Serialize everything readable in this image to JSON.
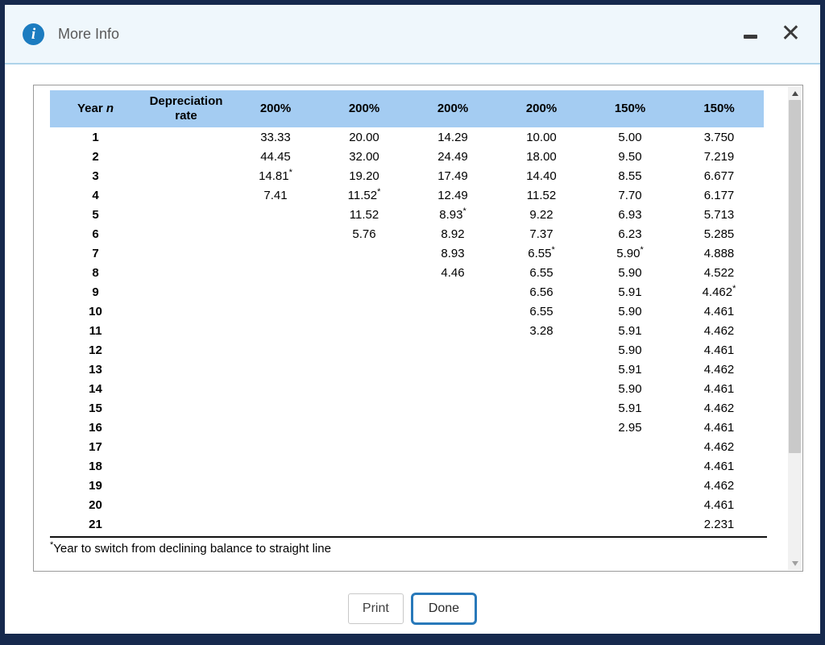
{
  "titlebar": {
    "title": "More Info",
    "info_glyph": "i",
    "close_glyph": "✕"
  },
  "table": {
    "headers": [
      {
        "label": "Year ",
        "italic": "n"
      },
      {
        "label": "Depreciation rate"
      },
      {
        "label": "200%"
      },
      {
        "label": "200%"
      },
      {
        "label": "200%"
      },
      {
        "label": "200%"
      },
      {
        "label": "150%"
      },
      {
        "label": "150%"
      }
    ],
    "rows": [
      {
        "year": "1",
        "values": [
          "33.33",
          "20.00",
          "14.29",
          "10.00",
          "5.00",
          "3.750"
        ]
      },
      {
        "year": "2",
        "values": [
          "44.45",
          "32.00",
          "24.49",
          "18.00",
          "9.50",
          "7.219"
        ]
      },
      {
        "year": "3",
        "values": [
          "14.81*",
          "19.20",
          "17.49",
          "14.40",
          "8.55",
          "6.677"
        ]
      },
      {
        "year": "4",
        "values": [
          "7.41",
          "11.52*",
          "12.49",
          "11.52",
          "7.70",
          "6.177"
        ]
      },
      {
        "year": "5",
        "values": [
          "",
          "11.52",
          "8.93*",
          "9.22",
          "6.93",
          "5.713"
        ]
      },
      {
        "year": "6",
        "values": [
          "",
          "5.76",
          "8.92",
          "7.37",
          "6.23",
          "5.285"
        ]
      },
      {
        "year": "7",
        "values": [
          "",
          "",
          "8.93",
          "6.55*",
          "5.90*",
          "4.888"
        ]
      },
      {
        "year": "8",
        "values": [
          "",
          "",
          "4.46",
          "6.55",
          "5.90",
          "4.522"
        ]
      },
      {
        "year": "9",
        "values": [
          "",
          "",
          "",
          "6.56",
          "5.91",
          "4.462*"
        ]
      },
      {
        "year": "10",
        "values": [
          "",
          "",
          "",
          "6.55",
          "5.90",
          "4.461"
        ]
      },
      {
        "year": "11",
        "values": [
          "",
          "",
          "",
          "3.28",
          "5.91",
          "4.462"
        ]
      },
      {
        "year": "12",
        "values": [
          "",
          "",
          "",
          "",
          "5.90",
          "4.461"
        ]
      },
      {
        "year": "13",
        "values": [
          "",
          "",
          "",
          "",
          "5.91",
          "4.462"
        ]
      },
      {
        "year": "14",
        "values": [
          "",
          "",
          "",
          "",
          "5.90",
          "4.461"
        ]
      },
      {
        "year": "15",
        "values": [
          "",
          "",
          "",
          "",
          "5.91",
          "4.462"
        ]
      },
      {
        "year": "16",
        "values": [
          "",
          "",
          "",
          "",
          "2.95",
          "4.461"
        ]
      },
      {
        "year": "17",
        "values": [
          "",
          "",
          "",
          "",
          "",
          "4.462"
        ]
      },
      {
        "year": "18",
        "values": [
          "",
          "",
          "",
          "",
          "",
          "4.461"
        ]
      },
      {
        "year": "19",
        "values": [
          "",
          "",
          "",
          "",
          "",
          "4.462"
        ]
      },
      {
        "year": "20",
        "values": [
          "",
          "",
          "",
          "",
          "",
          "4.461"
        ]
      },
      {
        "year": "21",
        "values": [
          "",
          "",
          "",
          "",
          "",
          "2.231"
        ]
      }
    ],
    "footnote_marker": "*",
    "footnote": "Year to switch from declining balance to straight line"
  },
  "buttons": {
    "print": "Print",
    "done": "Done"
  },
  "colors": {
    "accent_blue": "#2879ba",
    "table_header_blue": "#a4ccf2",
    "titlebar_bg": "#eff7fc",
    "window_border": "#16294d",
    "info_icon_blue": "#1c7cc0"
  }
}
